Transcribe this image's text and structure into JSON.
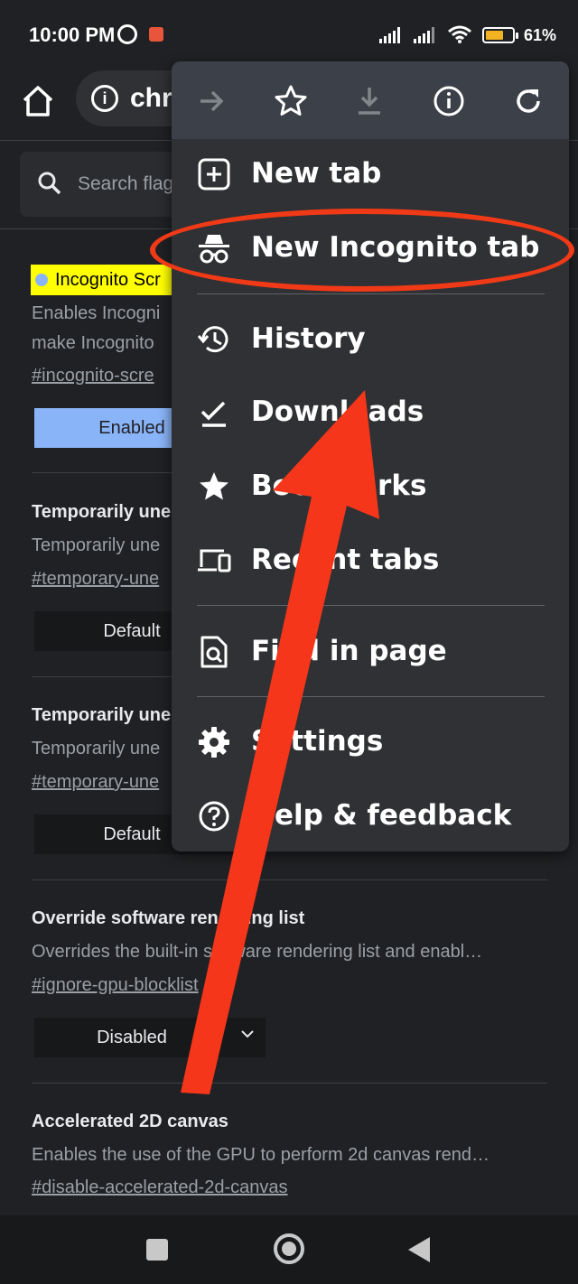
{
  "status_bar": {
    "time": "10:00 PM",
    "battery": "61%"
  },
  "toolbar": {
    "url_text": "chr"
  },
  "search": {
    "placeholder": "Search flag"
  },
  "flags": [
    {
      "highlight_title": "Incognito Scr",
      "desc1": "Enables Incogni",
      "desc2": "make Incognito",
      "link": "#incognito-scre",
      "value": "Enabled"
    },
    {
      "title": "Temporarily une",
      "desc": "Temporarily une",
      "link": "#temporary-une",
      "value": "Default"
    },
    {
      "title": "Temporarily une",
      "desc": "Temporarily une",
      "link": "#temporary-une",
      "value": "Default"
    },
    {
      "title": "Override software rendering list",
      "desc": "Overrides the built-in software rendering list and enabl…",
      "link": "#ignore-gpu-blocklist",
      "value": "Disabled"
    },
    {
      "title": "Accelerated 2D canvas",
      "desc": "Enables the use of the GPU to perform 2d canvas rend…",
      "link": "#disable-accelerated-2d-canvas"
    }
  ],
  "menu": {
    "items": [
      {
        "label": "New tab",
        "icon": "plus-square-icon"
      },
      {
        "label": "New Incognito tab",
        "icon": "incognito-icon"
      },
      {
        "label": "History",
        "icon": "history-icon"
      },
      {
        "label": "Downloads",
        "icon": "download-check-icon"
      },
      {
        "label": "Bookmarks",
        "icon": "star-icon"
      },
      {
        "label": "Recent tabs",
        "icon": "devices-icon"
      },
      {
        "label": "Find in page",
        "icon": "find-in-page-icon"
      },
      {
        "label": "Settings",
        "icon": "gear-icon"
      },
      {
        "label": "Help & feedback",
        "icon": "help-icon"
      }
    ]
  },
  "colors": {
    "annotation": "#f03a17",
    "highlight": "#ffff00",
    "accent": "#8ab4f8"
  }
}
